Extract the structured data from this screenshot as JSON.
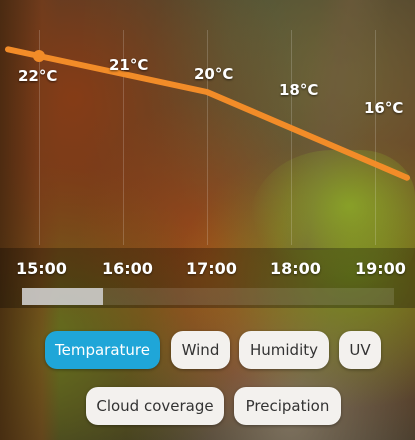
{
  "chart_data": {
    "type": "line",
    "x": [
      "15:00",
      "16:00",
      "17:00",
      "18:00",
      "19:00"
    ],
    "series": [
      {
        "values": [
          22,
          21,
          20,
          18,
          16
        ],
        "color": "#f28c28"
      }
    ],
    "data_labels": [
      "22°C",
      "21°C",
      "20°C",
      "18°C",
      "16°C"
    ],
    "ylim": [
      14,
      24
    ],
    "grid": true
  },
  "colors": {
    "line": "#f28c28",
    "active_chip": "#1fa6d8",
    "chip": "#f3f1ee"
  },
  "tabs": [
    {
      "label": "Temparature",
      "active": true
    },
    {
      "label": "Wind",
      "active": false
    },
    {
      "label": "Humidity",
      "active": false
    },
    {
      "label": "UV",
      "active": false
    },
    {
      "label": "Cloud coverage",
      "active": false
    },
    {
      "label": "Precipation",
      "active": false
    }
  ]
}
